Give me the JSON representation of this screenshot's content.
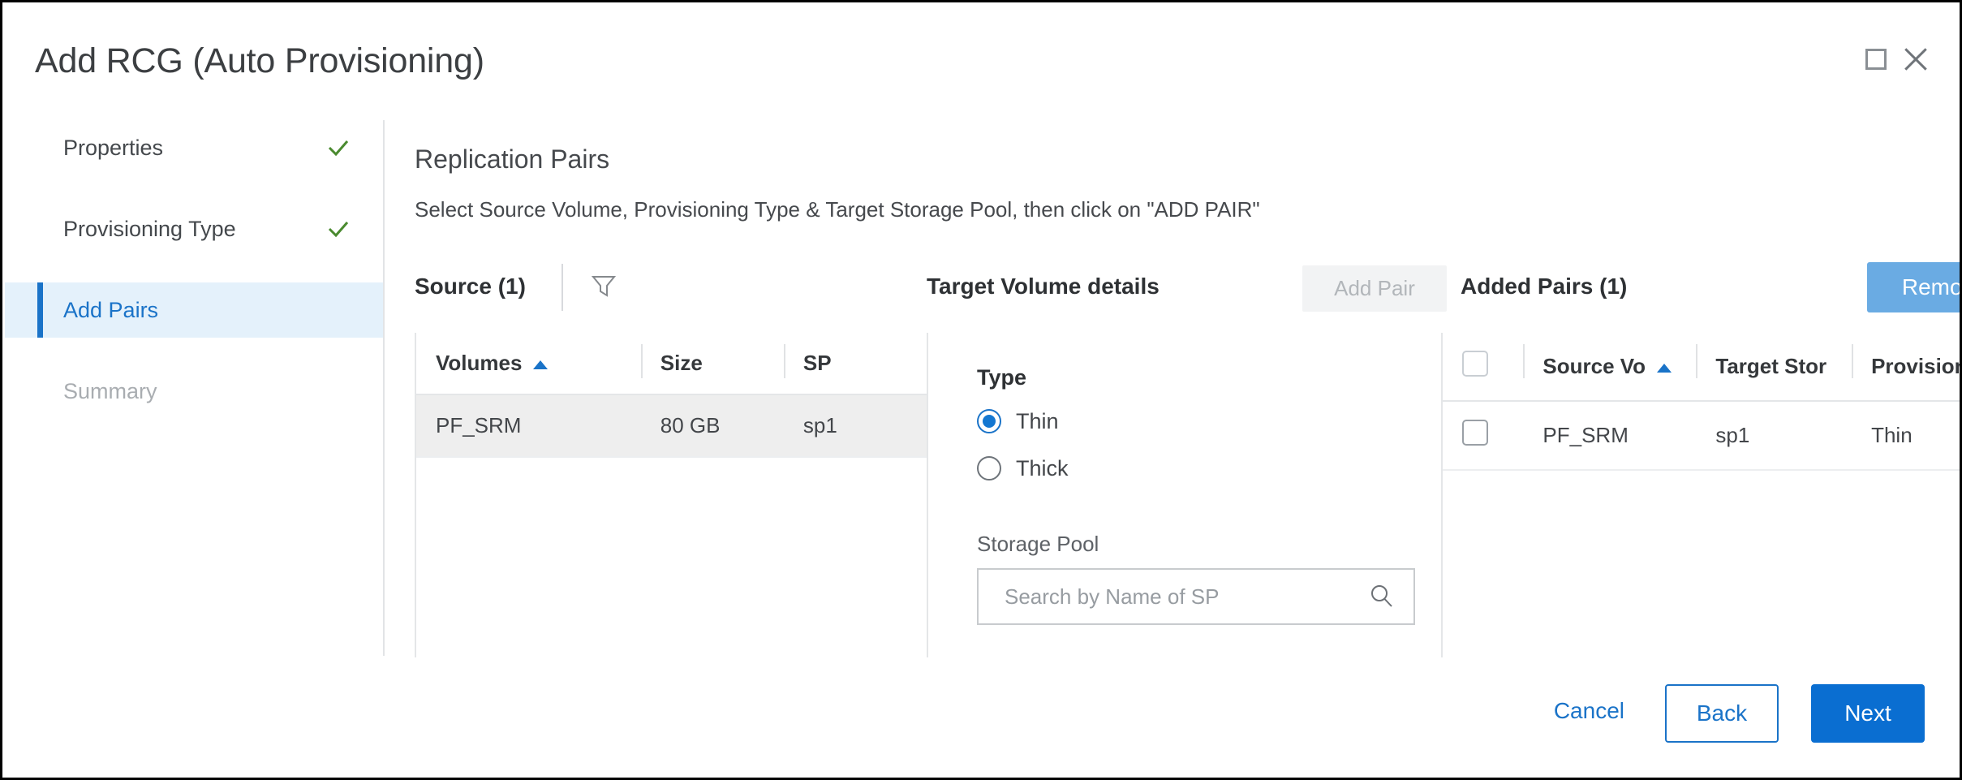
{
  "dialog": {
    "title": "Add RCG (Auto Provisioning)",
    "maximize_icon": "maximize-icon",
    "close_icon": "close-icon"
  },
  "sidebar": {
    "steps": [
      {
        "label": "Properties",
        "state": "done"
      },
      {
        "label": "Provisioning Type",
        "state": "done"
      },
      {
        "label": "Add Pairs",
        "state": "active"
      },
      {
        "label": "Summary",
        "state": "disabled"
      }
    ]
  },
  "content": {
    "title": "Replication Pairs",
    "subtitle": "Select Source Volume, Provisioning Type & Target Storage Pool, then click on \"ADD PAIR\""
  },
  "toolbar": {
    "source_label": "Source (1)",
    "filter_icon": "filter-icon",
    "target_label": "Target Volume details",
    "add_pair_label": "Add Pair",
    "added_label": "Added Pairs (1)",
    "remove_label": "Remove"
  },
  "source_table": {
    "columns": [
      "Volumes",
      "Size",
      "SP"
    ],
    "sort_column": "Volumes",
    "sort_direction": "asc",
    "rows": [
      {
        "volume": "PF_SRM",
        "size": "80 GB",
        "sp": "sp1",
        "selected": true
      }
    ]
  },
  "target_details": {
    "type_label": "Type",
    "options": [
      {
        "label": "Thin",
        "selected": true
      },
      {
        "label": "Thick",
        "selected": false
      }
    ],
    "storage_pool_label": "Storage Pool",
    "storage_pool_value": "",
    "storage_pool_placeholder": "Search by Name of SP",
    "search_icon": "search-icon"
  },
  "added_table": {
    "columns": [
      "Source Vo",
      "Target Stor",
      "Provision T"
    ],
    "sort_column": "Source Vo",
    "sort_direction": "asc",
    "rows": [
      {
        "source_volume": "PF_SRM",
        "target_storage": "sp1",
        "provision_type": "Thin",
        "checked": false
      }
    ]
  },
  "footer": {
    "cancel_label": "Cancel",
    "back_label": "Back",
    "next_label": "Next"
  },
  "colors": {
    "accent": "#0a6ed1",
    "accent_light": "#6aabe3",
    "active_bg": "#e4f1fb",
    "check_green": "#4a8a2f"
  }
}
